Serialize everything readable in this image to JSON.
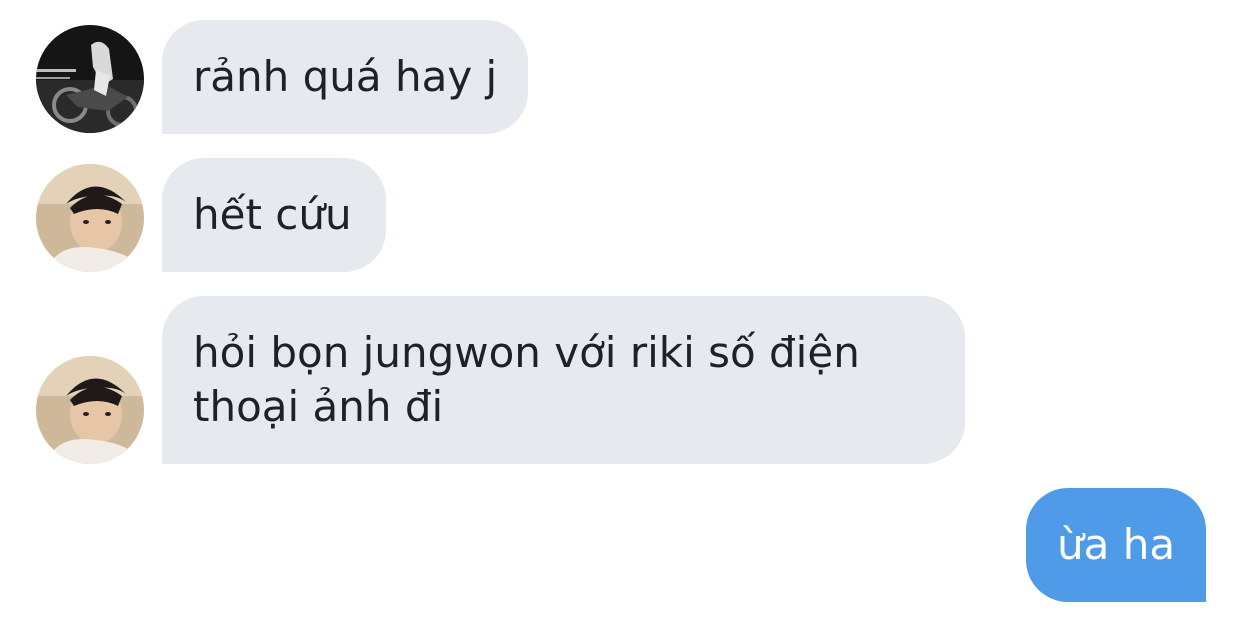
{
  "colors": {
    "incoming_bubble": "#e6e9ee",
    "outgoing_bubble": "#4f9be8",
    "text_dark": "#1e2126",
    "text_light": "#ffffff"
  },
  "messages": [
    {
      "direction": "incoming",
      "avatar": "avatar-bw-motorbike",
      "lines": [
        "rảnh quá hay j"
      ]
    },
    {
      "direction": "incoming",
      "avatar": "avatar-beach-boy",
      "lines": [
        "hết cứu"
      ]
    },
    {
      "direction": "incoming",
      "avatar": "avatar-beach-boy",
      "lines": [
        "hỏi bọn jungwon với riki số điện",
        "thoại ảnh đi"
      ]
    },
    {
      "direction": "outgoing",
      "lines": [
        "ừa ha"
      ]
    }
  ]
}
